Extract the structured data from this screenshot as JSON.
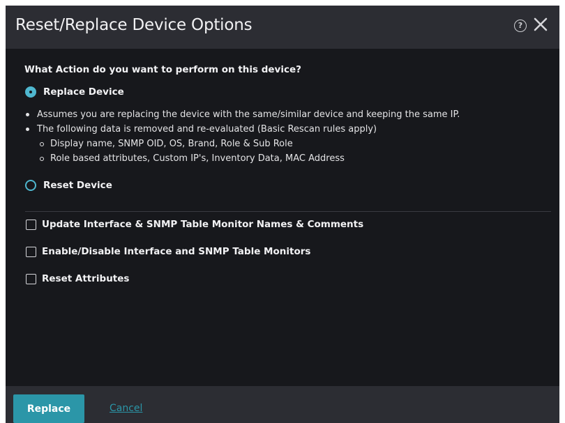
{
  "dialog": {
    "title": "Reset/Replace Device Options",
    "help_icon": "help-icon",
    "close_icon": "close-icon"
  },
  "question": "What Action do you want to perform on this device?",
  "options": [
    {
      "label": "Replace Device",
      "checked": true
    },
    {
      "label": "Reset Device",
      "checked": false
    }
  ],
  "replace_details": {
    "bullets": [
      "Assumes you are replacing the device with the same/similar device and keeping the same IP.",
      "The following data is removed and re-evaluated (Basic Rescan rules apply)"
    ],
    "sub_bullets": [
      "Display name, SNMP OID, OS, Brand, Role & Sub Role",
      "Role based attributes, Custom IP's, Inventory Data, MAC Address"
    ]
  },
  "checkboxes": [
    {
      "label": "Update Interface & SNMP Table Monitor Names & Comments",
      "checked": false
    },
    {
      "label": "Enable/Disable Interface and SNMP Table Monitors",
      "checked": false
    },
    {
      "label": "Reset Attributes",
      "checked": false
    }
  ],
  "footer": {
    "primary_label": "Replace",
    "cancel_label": "Cancel"
  },
  "colors": {
    "accent": "#2b96a8",
    "radio_accent": "#4fb7cf",
    "background": "#17181c",
    "header_footer": "#2c2d33"
  }
}
